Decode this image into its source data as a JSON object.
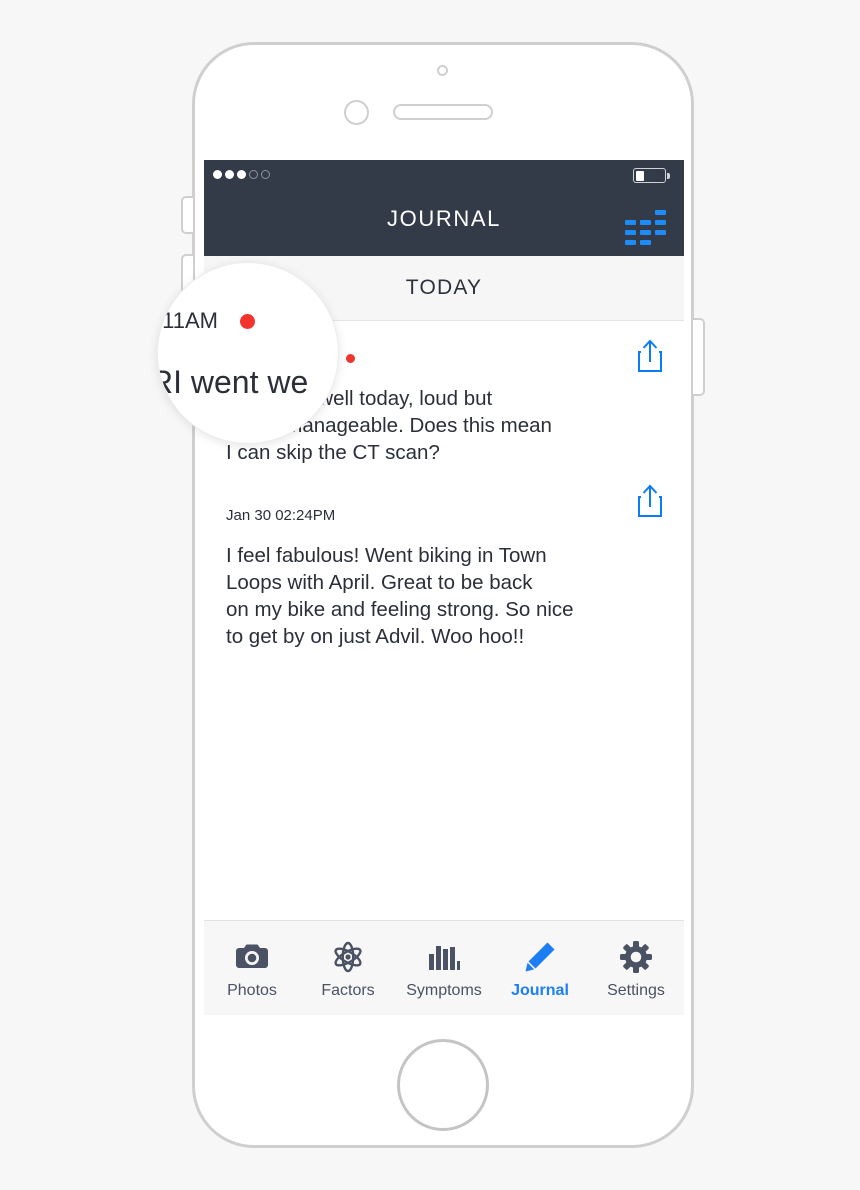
{
  "device": {
    "name": "smartphone-mockup",
    "hardware": {
      "proximity_sensor": "proximity-sensor",
      "front_camera": "front-camera",
      "earpiece_speaker": "earpiece-speaker",
      "home_button": "home-button",
      "mute_switch": "mute-switch",
      "volume_up": "volume-up-button",
      "volume_down": "volume-down-button",
      "power": "power-button"
    }
  },
  "status_bar": {
    "signal_dots_filled": 3,
    "signal_dots_total": 5,
    "battery_percent": 30
  },
  "nav_bar": {
    "title": "JOURNAL",
    "chart_icon": "chart-bars-icon",
    "accent_color": "#1d8bf8",
    "background_color": "#333b48"
  },
  "section_header": {
    "label": "TODAY"
  },
  "entries": [
    {
      "date": "Jan 31 08:11AM",
      "flagged": true,
      "text": "MRI went well today, loud but\ntotally manageable. Does this mean\nI can skip the CT scan?",
      "share_icon": "share-icon"
    },
    {
      "date": "Jan 30 02:24PM",
      "flagged": false,
      "text": "I feel fabulous! Went biking in Town\nLoops with April. Great to be back\non my bike and feeling strong. So nice\nto get by on just Advil. Woo hoo!!",
      "share_icon": "share-icon"
    }
  ],
  "fab": {
    "label": "+",
    "name": "add-entry-fab",
    "color": "#4a9af5"
  },
  "tab_bar": {
    "active_color": "#1d7ef3",
    "inactive_color": "#4a5263",
    "items": [
      {
        "label": "Photos",
        "icon": "camera-icon",
        "active": false
      },
      {
        "label": "Factors",
        "icon": "atom-icon",
        "active": false
      },
      {
        "label": "Symptoms",
        "icon": "bar-chart-icon",
        "active": false
      },
      {
        "label": "Journal",
        "icon": "pencil-icon",
        "active": true
      },
      {
        "label": "Settings",
        "icon": "gear-icon",
        "active": false
      }
    ]
  },
  "magnifier": {
    "name": "magnifier-loupe",
    "zoomed_time": ":11AM",
    "zoomed_text": "RI went we",
    "flag_dot_color": "#f2332e"
  }
}
